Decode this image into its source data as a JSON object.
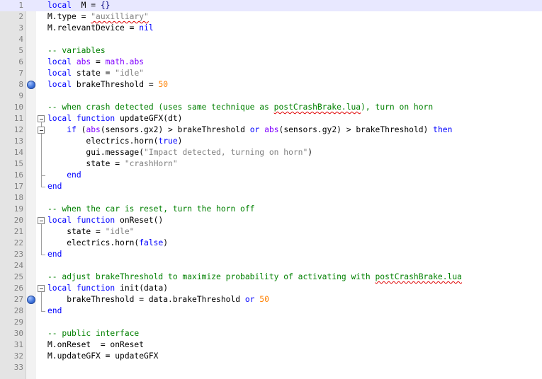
{
  "editor": {
    "current_line": 1,
    "lines": [
      {
        "n": "1",
        "bp": false,
        "fold": "",
        "tokens": [
          [
            "kw",
            "local"
          ],
          [
            "",
            "  M = "
          ],
          [
            "op",
            "{}"
          ]
        ]
      },
      {
        "n": "2",
        "bp": false,
        "fold": "",
        "tokens": [
          [
            "",
            "M.type = "
          ],
          [
            "st sq",
            "\"auxilliary\""
          ]
        ]
      },
      {
        "n": "3",
        "bp": false,
        "fold": "",
        "tokens": [
          [
            "",
            "M.relevantDevice = "
          ],
          [
            "kw",
            "nil"
          ]
        ]
      },
      {
        "n": "4",
        "bp": false,
        "fold": "",
        "tokens": []
      },
      {
        "n": "5",
        "bp": false,
        "fold": "",
        "tokens": [
          [
            "cm",
            "-- variables"
          ]
        ]
      },
      {
        "n": "6",
        "bp": false,
        "fold": "",
        "tokens": [
          [
            "kw",
            "local"
          ],
          [
            "",
            " "
          ],
          [
            "fn",
            "abs"
          ],
          [
            "",
            " = "
          ],
          [
            "fn",
            "math.abs"
          ]
        ]
      },
      {
        "n": "7",
        "bp": false,
        "fold": "",
        "tokens": [
          [
            "kw",
            "local"
          ],
          [
            "",
            " state = "
          ],
          [
            "st",
            "\"idle\""
          ]
        ]
      },
      {
        "n": "8",
        "bp": true,
        "fold": "",
        "tokens": [
          [
            "kw",
            "local"
          ],
          [
            "",
            " brakeThreshold = "
          ],
          [
            "nm",
            "50"
          ]
        ]
      },
      {
        "n": "9",
        "bp": false,
        "fold": "",
        "tokens": []
      },
      {
        "n": "10",
        "bp": false,
        "fold": "",
        "tokens": [
          [
            "cm",
            "-- when crash detected (uses same technique as "
          ],
          [
            "cm sq",
            "postCrashBrake.lua"
          ],
          [
            "cm",
            "), turn on horn"
          ]
        ]
      },
      {
        "n": "11",
        "bp": false,
        "fold": "start",
        "tokens": [
          [
            "kw",
            "local"
          ],
          [
            "",
            " "
          ],
          [
            "kw",
            "function"
          ],
          [
            "",
            " updateGFX(dt)"
          ]
        ]
      },
      {
        "n": "12",
        "bp": false,
        "fold": "start",
        "tokens": [
          [
            "",
            "    "
          ],
          [
            "kw",
            "if"
          ],
          [
            "",
            " ("
          ],
          [
            "fn",
            "abs"
          ],
          [
            "",
            "(sensors.gx2) > brakeThreshold "
          ],
          [
            "kw",
            "or"
          ],
          [
            "",
            " "
          ],
          [
            "fn",
            "abs"
          ],
          [
            "",
            "(sensors.gy2) > brakeThreshold) "
          ],
          [
            "kw",
            "then"
          ]
        ]
      },
      {
        "n": "13",
        "bp": false,
        "fold": "mid",
        "tokens": [
          [
            "",
            "        electrics.horn("
          ],
          [
            "kw",
            "true"
          ],
          [
            "",
            ")"
          ]
        ]
      },
      {
        "n": "14",
        "bp": false,
        "fold": "mid",
        "tokens": [
          [
            "",
            "        gui.message("
          ],
          [
            "st",
            "\"Impact detected, turning on horn\""
          ],
          [
            "",
            ")"
          ]
        ]
      },
      {
        "n": "15",
        "bp": false,
        "fold": "mid",
        "tokens": [
          [
            "",
            "        state = "
          ],
          [
            "st",
            "\"crashHorn\""
          ]
        ]
      },
      {
        "n": "16",
        "bp": false,
        "fold": "end",
        "tokens": [
          [
            "",
            "    "
          ],
          [
            "kw",
            "end"
          ]
        ]
      },
      {
        "n": "17",
        "bp": false,
        "fold": "end",
        "tokens": [
          [
            "kw",
            "end"
          ]
        ]
      },
      {
        "n": "18",
        "bp": false,
        "fold": "",
        "tokens": []
      },
      {
        "n": "19",
        "bp": false,
        "fold": "",
        "tokens": [
          [
            "cm",
            "-- when the car is reset, turn the horn off"
          ]
        ]
      },
      {
        "n": "20",
        "bp": false,
        "fold": "start",
        "tokens": [
          [
            "kw",
            "local"
          ],
          [
            "",
            " "
          ],
          [
            "kw",
            "function"
          ],
          [
            "",
            " onReset()"
          ]
        ]
      },
      {
        "n": "21",
        "bp": false,
        "fold": "mid",
        "tokens": [
          [
            "",
            "    state = "
          ],
          [
            "st",
            "\"idle\""
          ]
        ]
      },
      {
        "n": "22",
        "bp": false,
        "fold": "mid",
        "tokens": [
          [
            "",
            "    electrics.horn("
          ],
          [
            "kw",
            "false"
          ],
          [
            "",
            ")"
          ]
        ]
      },
      {
        "n": "23",
        "bp": false,
        "fold": "end",
        "tokens": [
          [
            "kw",
            "end"
          ]
        ]
      },
      {
        "n": "24",
        "bp": false,
        "fold": "",
        "tokens": []
      },
      {
        "n": "25",
        "bp": false,
        "fold": "",
        "tokens": [
          [
            "cm",
            "-- adjust brakeThreshold to maximize probability of activating with "
          ],
          [
            "cm sq",
            "postCrashBrake.lua"
          ]
        ]
      },
      {
        "n": "26",
        "bp": false,
        "fold": "start",
        "tokens": [
          [
            "kw",
            "local"
          ],
          [
            "",
            " "
          ],
          [
            "kw",
            "function"
          ],
          [
            "",
            " init(data)"
          ]
        ]
      },
      {
        "n": "27",
        "bp": true,
        "fold": "mid",
        "tokens": [
          [
            "",
            "    brakeThreshold = data.brakeThreshold "
          ],
          [
            "kw",
            "or"
          ],
          [
            "",
            " "
          ],
          [
            "nm",
            "50"
          ]
        ]
      },
      {
        "n": "28",
        "bp": false,
        "fold": "end",
        "tokens": [
          [
            "kw",
            "end"
          ]
        ]
      },
      {
        "n": "29",
        "bp": false,
        "fold": "",
        "tokens": []
      },
      {
        "n": "30",
        "bp": false,
        "fold": "",
        "tokens": [
          [
            "cm",
            "-- public interface"
          ]
        ]
      },
      {
        "n": "31",
        "bp": false,
        "fold": "",
        "tokens": [
          [
            "",
            "M.onReset  = onReset"
          ]
        ]
      },
      {
        "n": "32",
        "bp": false,
        "fold": "",
        "tokens": [
          [
            "",
            "M.updateGFX = updateGFX"
          ]
        ]
      },
      {
        "n": "33",
        "bp": false,
        "fold": "",
        "tokens": []
      }
    ]
  }
}
